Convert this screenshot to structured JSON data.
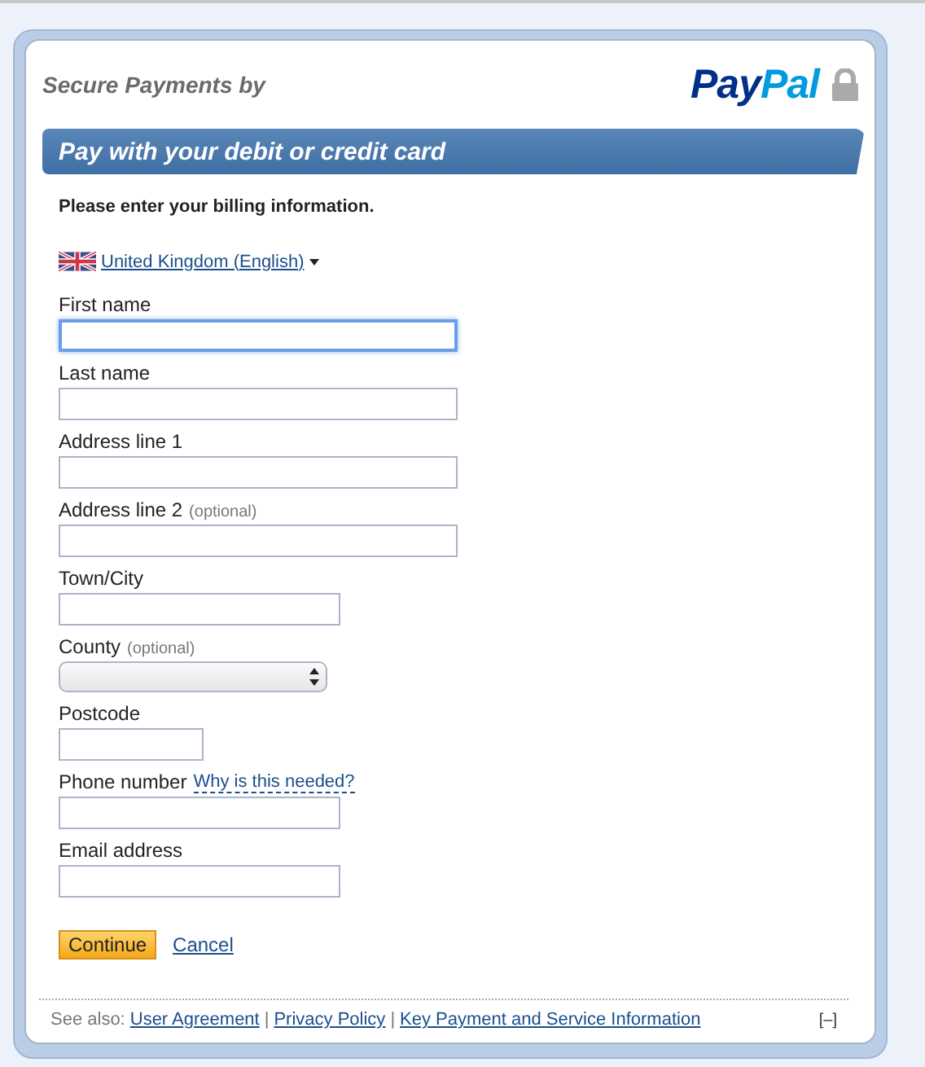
{
  "header": {
    "secure_label": "Secure Payments by",
    "logo": {
      "dark_part": "Pay",
      "light_part": "Pal"
    }
  },
  "banner": {
    "title": "Pay with your debit or credit card"
  },
  "intro": "Please enter your billing information.",
  "language": {
    "label": "United Kingdom (English)"
  },
  "fields": [
    {
      "kind": "text",
      "label": "First name",
      "focused": true
    },
    {
      "kind": "text",
      "label": "Last name",
      "focused": false
    },
    {
      "kind": "text",
      "label": "Address line 1",
      "focused": false
    },
    {
      "kind": "text",
      "label": "Address line 2",
      "note": "(optional)",
      "focused": false
    },
    {
      "kind": "text",
      "label": "Town/City",
      "focused": false
    },
    {
      "kind": "select",
      "label": "County",
      "note": "(optional)",
      "focused": false
    },
    {
      "kind": "text",
      "label": "Postcode",
      "focused": false
    },
    {
      "kind": "text",
      "label": "Phone number",
      "help_link": "Why is this needed?",
      "focused": false
    },
    {
      "kind": "text",
      "label": "Email address",
      "focused": false
    }
  ],
  "actions": {
    "continue": "Continue",
    "cancel": "Cancel"
  },
  "footer": {
    "see_also": "See also:",
    "links": [
      "User Agreement",
      "Privacy Policy",
      "Key Payment and Service Information"
    ],
    "separator": "|",
    "collapse": "[–]"
  }
}
